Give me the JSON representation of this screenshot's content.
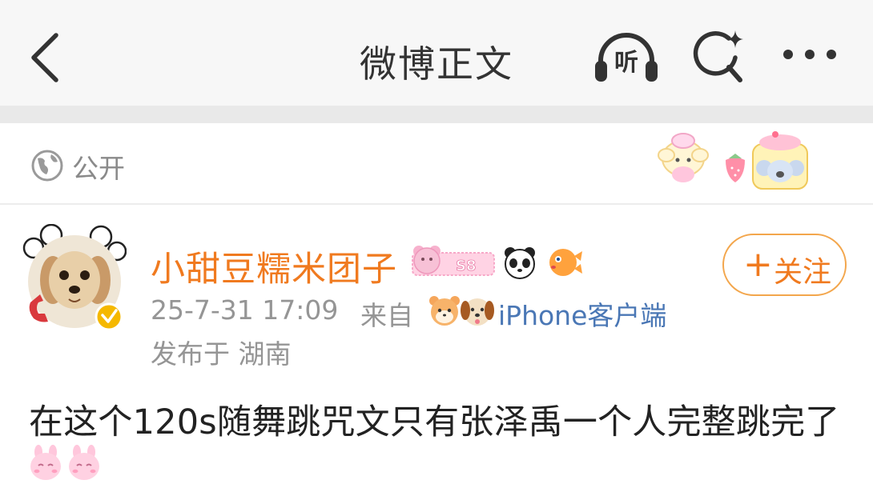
{
  "navbar": {
    "title": "微博正文",
    "listen_label": "听",
    "icons": [
      "back-chevron-icon",
      "headphones-icon",
      "search-sparkle-icon",
      "more-dots-icon"
    ]
  },
  "visibility": {
    "label": "公开",
    "icon": "globe-icon"
  },
  "post": {
    "username": "小甜豆糯米团子",
    "badges": [
      "bear-level-badge",
      "panda-icon",
      "pufferfish-icon"
    ],
    "badge_level": "S8",
    "follow": {
      "plus": "+",
      "label": "关注"
    },
    "time": "25-7-31 17:09",
    "from_label": "来自",
    "client": "iPhone客户端",
    "location": "发布于 湖南",
    "body": "在这个120s随舞跳咒文只有张泽禹一个人完整跳完了",
    "body_emojis": [
      "bunny-emoji",
      "bunny-emoji"
    ]
  },
  "colors": {
    "username": "#f07a1f",
    "follow_border": "#f3a64c",
    "client_link": "#4a77b5",
    "meta_gray": "#959595",
    "nav_bg": "#f7f7f7",
    "verified_badge": "#f5b800"
  }
}
